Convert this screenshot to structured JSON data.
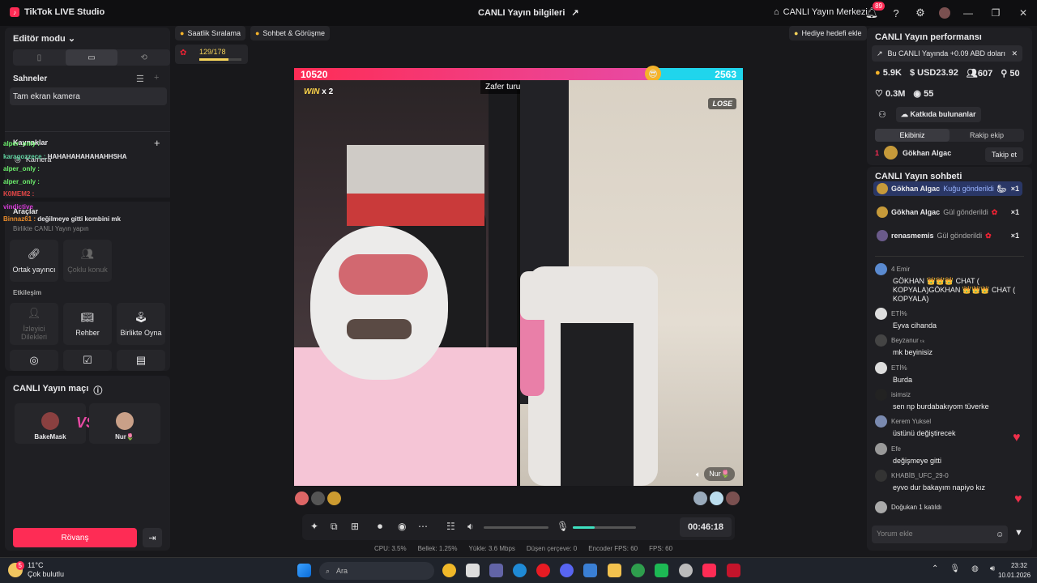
{
  "app": {
    "name": "TikTok LIVE Studio",
    "live_info": "CANLI Yayın bilgileri",
    "center": "CANLI Yayın Merkezi",
    "notif_count": "89"
  },
  "left": {
    "editor_mode": "Editör modu",
    "scenes_title": "Sahneler",
    "scene_item": "Tam ekran kamera",
    "sources_title": "Kaynaklar",
    "source_camera": "Kamera",
    "tools_title": "Araçlar",
    "tools_sub": "Birlikte CANLI Yayın yapın",
    "tool_cohost": "Ortak yayıncı",
    "tool_multi": "Çoklu konuk",
    "interaction_title": "Etkileşim",
    "tool_requests": "İzleyici Dilekleri",
    "tool_guide": "Rehber",
    "tool_play": "Birlikte Oyna",
    "match_title": "CANLI Yayın maçı",
    "player1": "BakeMask",
    "player2": "Nur🌷",
    "vs": "VS",
    "rematch": "Rövanş"
  },
  "overlay_chat": [
    {
      "user": "alper_only :",
      "msg": "",
      "cls": "n1"
    },
    {
      "user": "karagozzece :",
      "msg": "HAHAHAHAHAHAHHSHA",
      "cls": "n1"
    },
    {
      "user": "alper_only :",
      "msg": "",
      "cls": "n1"
    },
    {
      "user": "alper_only :",
      "msg": "",
      "cls": "n1"
    },
    {
      "user": "K0MEM2 :",
      "msg": "",
      "cls": "n3"
    },
    {
      "user": "vindictive",
      "msg": "",
      "cls": "n2"
    },
    {
      "user": "Binnaz61 :",
      "msg": "değilmeye gitti kombini mk",
      "cls": "n2"
    }
  ],
  "top_pills": {
    "ranking": "Saatlik Sıralama",
    "chat": "Sohbet & Görüşme",
    "gift_goal": "Hediye hedefi ekle",
    "rank_val": "129/178"
  },
  "battle": {
    "score_left": "10520",
    "score_right": "2563",
    "score_left_frac": 0.8,
    "round_timer": "Zafer turu 02:34",
    "win": "WIN",
    "win_mult": "x 2",
    "lose": "LOSE",
    "guest_name": "Nur🌷"
  },
  "controls": {
    "elapsed": "00:46:18",
    "volume_level": 0,
    "mic_level": 0.35
  },
  "stats": [
    {
      "label": "CPU:",
      "val": "3.5%"
    },
    {
      "label": "Bellek:",
      "val": "1.25%"
    },
    {
      "label": "Yükle:",
      "val": "3.6 Mbps"
    },
    {
      "label": "Düşen çerçeve:",
      "val": "0"
    },
    {
      "label": "Encoder FPS:",
      "val": "60"
    },
    {
      "label": "FPS:",
      "val": "60"
    }
  ],
  "perf": {
    "title": "CANLI Yayın performansı",
    "earn_msg": "Bu CANLI Yayında +0.09 ABD doları",
    "m1": "5.9K",
    "m2": "USD23.92",
    "m3": "607",
    "m4": "50",
    "m5": "0.3M",
    "m6": "55",
    "contributors": "Katkıda bulunanlar",
    "tab_ours": "Ekibiniz",
    "tab_rival": "Rakip ekip",
    "rank": "1",
    "rank_user": "Gökhan Algac",
    "follow": "Takip et"
  },
  "chat": {
    "title": "CANLI Yayın sohbeti",
    "gifts": [
      {
        "user": "Gökhan Algac",
        "text": "Kuğu gönderildi",
        "mult": "×1"
      },
      {
        "user": "Gökhan Algac",
        "text": "Gül gönderildi",
        "mult": "×1"
      },
      {
        "user": "renasmemis",
        "text": "Gül gönderildi",
        "mult": "×1"
      }
    ],
    "messages": [
      {
        "user": "4 Emir",
        "text": "GÖKHAN 👑👑👑 CHAT ( KOPYALA)GÖKHAN 👑👑👑 CHAT ( KOPYALA)"
      },
      {
        "user": "ETİ%",
        "text": "Eyva cihanda"
      },
      {
        "user": "Beyzanur ₜₖ",
        "text": "mk beyinisiz"
      },
      {
        "user": "ETİ%",
        "text": "Burda"
      },
      {
        "user": "isimsiz",
        "text": "sen np burdabakıyom tüverke"
      },
      {
        "user": "Kerem Yuksel",
        "text": "üstünü değiştirecek"
      },
      {
        "user": "Efe",
        "text": "değişmeye gitti"
      },
      {
        "user": "KHABİB_UFC_29-0",
        "text": "eyvo dur bakayım napiyo kız"
      }
    ],
    "joined_user": "Doğukan 1 katıldı",
    "input_placeholder": "Yorum ekle"
  },
  "taskbar": {
    "temp": "11°C",
    "weather": "Çok bulutlu",
    "search": "Ara",
    "time": "23:32",
    "date": "10.01.2026",
    "weather_badge": "5"
  }
}
